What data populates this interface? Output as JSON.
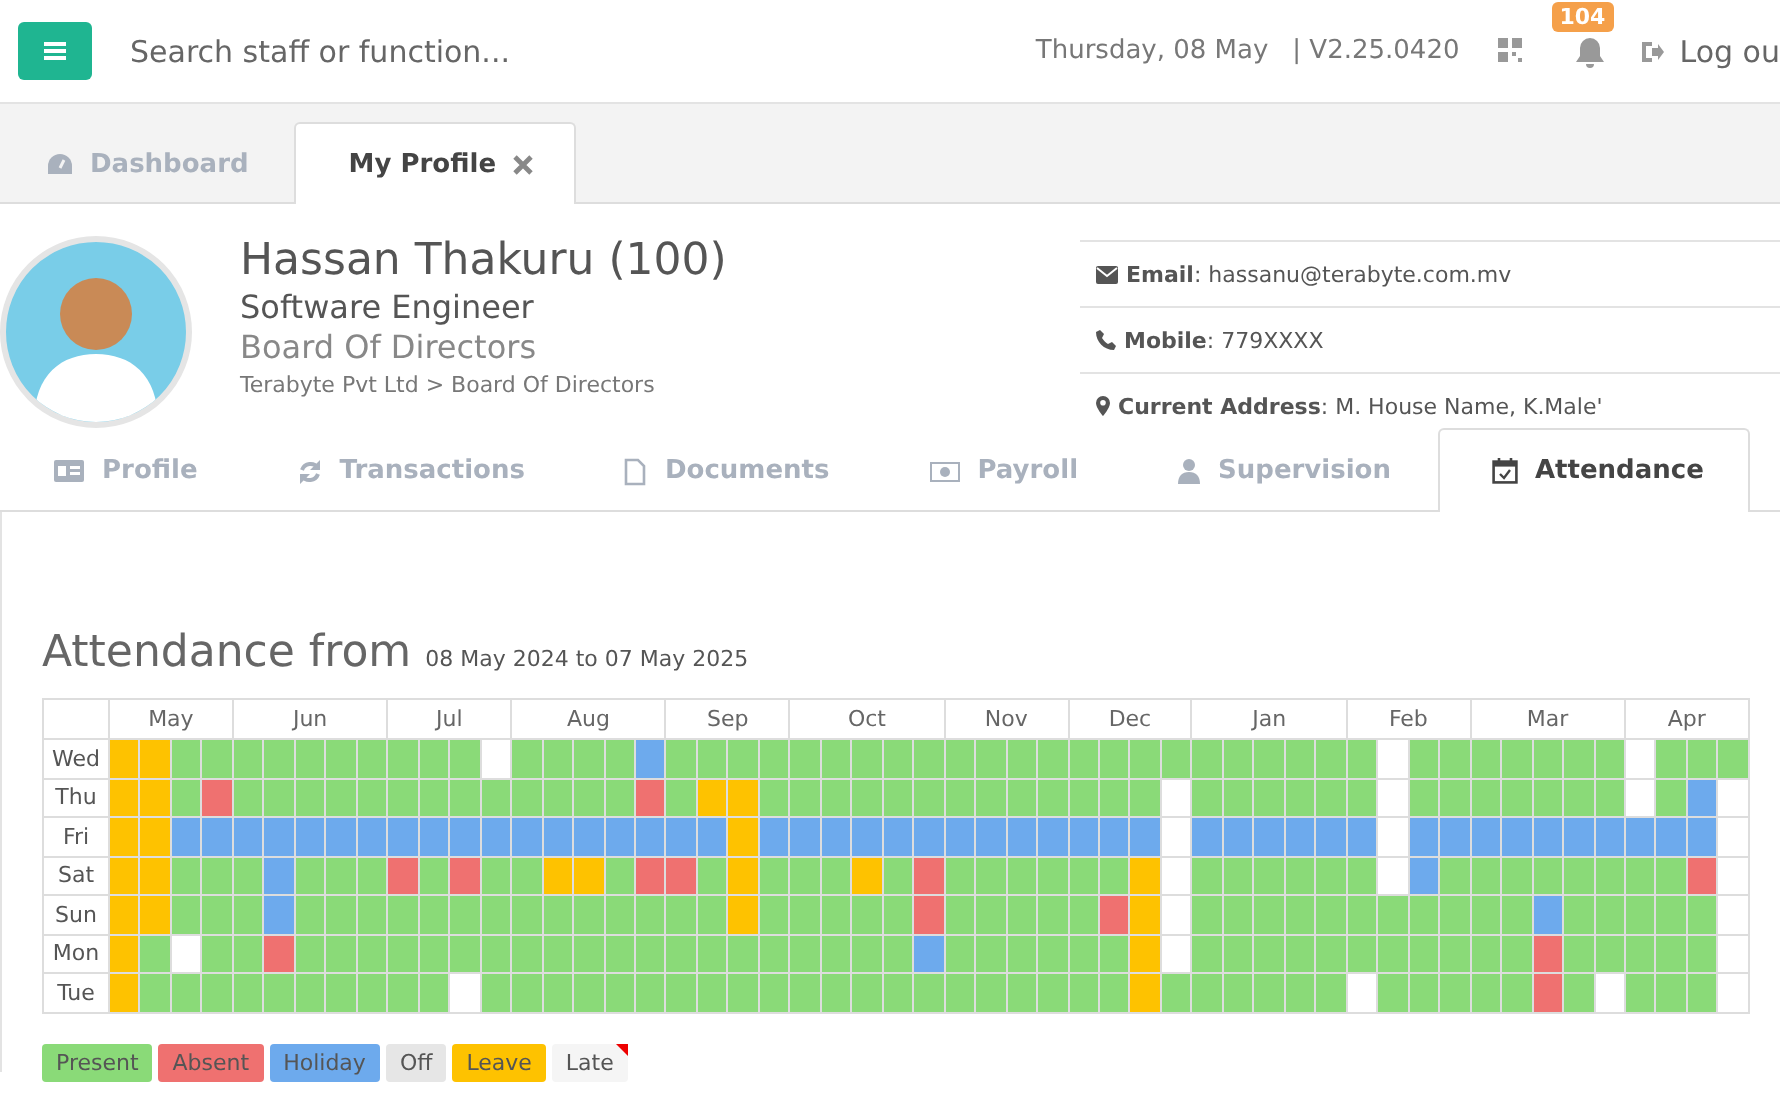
{
  "top_bar": {
    "search": {
      "placeholder": "Search staff or function..."
    },
    "date": "Thursday, 08 May",
    "version": "| V2.25.0420",
    "notifications": "104",
    "logout": "Log ou"
  },
  "page_tabs": [
    {
      "label": "Dashboard",
      "selected": false,
      "closable": false
    },
    {
      "label": "My Profile",
      "selected": true,
      "closable": true
    }
  ],
  "profile": {
    "name": "Hassan Thakuru (100)",
    "position": "Software Engineer",
    "department": "Board Of Directors",
    "breadcrumb": "Terabyte Pvt Ltd > Board Of Directors",
    "contacts": [
      {
        "kind": "email",
        "text": "**Email**: hassanu@terabyte.com.mv"
      },
      {
        "kind": "phone",
        "text": "**Mobile**: 779XXXX"
      },
      {
        "kind": "address",
        "text": "**Current Address**: M. House Name, K.Male'"
      }
    ]
  },
  "section_tabs": [
    {
      "kind": "profile",
      "label": "Profile",
      "selected": false
    },
    {
      "kind": "transactions",
      "label": "Transactions",
      "selected": false
    },
    {
      "kind": "documents",
      "label": "Documents",
      "selected": false
    },
    {
      "kind": "payroll",
      "label": "Payroll",
      "selected": false
    },
    {
      "kind": "supervision",
      "label": "Supervision",
      "selected": false
    },
    {
      "kind": "attendance",
      "label": "Attendance",
      "selected": true
    }
  ],
  "attendance": {
    "title": "Attendance from",
    "range": "08 May 2024 to 07 May 2025",
    "months": [
      "May",
      "Jun",
      "Jul",
      "Aug",
      "Sep",
      "Oct",
      "Nov",
      "Dec",
      "Jan",
      "Feb",
      "Mar",
      "Apr"
    ],
    "rows": [
      {
        "day": "Wed",
        "cells": [
          {
            "kind": "leave"
          },
          {
            "kind": "leave"
          },
          {
            "kind": "present"
          },
          {
            "kind": "present"
          },
          {
            "kind": "present"
          },
          {
            "kind": "present"
          },
          {
            "kind": "present"
          },
          {
            "kind": "present"
          },
          {
            "kind": "present"
          },
          {
            "kind": "present"
          },
          {
            "kind": "present"
          },
          {
            "kind": "present"
          },
          {
            "kind": "none"
          },
          {
            "kind": "present"
          },
          {
            "kind": "present"
          },
          {
            "kind": "present"
          },
          {
            "kind": "present"
          },
          {
            "kind": "holiday"
          },
          {
            "kind": "present"
          },
          {
            "kind": "present"
          },
          {
            "kind": "present"
          },
          {
            "kind": "present"
          },
          {
            "kind": "present"
          },
          {
            "kind": "present"
          },
          {
            "kind": "present"
          },
          {
            "kind": "present"
          },
          {
            "kind": "present"
          },
          {
            "kind": "present"
          },
          {
            "kind": "present"
          },
          {
            "kind": "present"
          },
          {
            "kind": "present"
          },
          {
            "kind": "present"
          },
          {
            "kind": "present"
          },
          {
            "kind": "present"
          },
          {
            "kind": "present"
          },
          {
            "kind": "present"
          },
          {
            "kind": "present"
          },
          {
            "kind": "present"
          },
          {
            "kind": "present"
          },
          {
            "kind": "present"
          },
          {
            "kind": "present"
          },
          {
            "kind": "none"
          },
          {
            "kind": "present"
          },
          {
            "kind": "present"
          },
          {
            "kind": "present"
          },
          {
            "kind": "present"
          },
          {
            "kind": "present"
          },
          {
            "kind": "present"
          },
          {
            "kind": "present"
          },
          {
            "kind": "none"
          },
          {
            "kind": "present"
          },
          {
            "kind": "present"
          },
          {
            "kind": "present"
          }
        ]
      },
      {
        "day": "Thu",
        "cells": [
          {
            "kind": "leave"
          },
          {
            "kind": "leave"
          },
          {
            "kind": "present"
          },
          {
            "kind": "absent"
          },
          {
            "kind": "present"
          },
          {
            "kind": "present"
          },
          {
            "kind": "present"
          },
          {
            "kind": "present"
          },
          {
            "kind": "present"
          },
          {
            "kind": "present"
          },
          {
            "kind": "present"
          },
          {
            "kind": "present"
          },
          {
            "kind": "present"
          },
          {
            "kind": "present"
          },
          {
            "kind": "present"
          },
          {
            "kind": "present"
          },
          {
            "kind": "present"
          },
          {
            "kind": "absent"
          },
          {
            "kind": "present"
          },
          {
            "kind": "leave"
          },
          {
            "kind": "leave"
          },
          {
            "kind": "present"
          },
          {
            "kind": "present"
          },
          {
            "kind": "present"
          },
          {
            "kind": "present"
          },
          {
            "kind": "present"
          },
          {
            "kind": "present"
          },
          {
            "kind": "present"
          },
          {
            "kind": "present"
          },
          {
            "kind": "present"
          },
          {
            "kind": "present"
          },
          {
            "kind": "present"
          },
          {
            "kind": "present"
          },
          {
            "kind": "present"
          },
          {
            "kind": "none"
          },
          {
            "kind": "present"
          },
          {
            "kind": "present"
          },
          {
            "kind": "present"
          },
          {
            "kind": "present"
          },
          {
            "kind": "present"
          },
          {
            "kind": "present"
          },
          {
            "kind": "none"
          },
          {
            "kind": "present"
          },
          {
            "kind": "present"
          },
          {
            "kind": "present"
          },
          {
            "kind": "present"
          },
          {
            "kind": "present"
          },
          {
            "kind": "present"
          },
          {
            "kind": "present"
          },
          {
            "kind": "none"
          },
          {
            "kind": "present"
          },
          {
            "kind": "holiday"
          },
          {
            "kind": "none"
          }
        ]
      },
      {
        "day": "Fri",
        "cells": [
          {
            "kind": "leave"
          },
          {
            "kind": "leave"
          },
          {
            "kind": "holiday"
          },
          {
            "kind": "holiday"
          },
          {
            "kind": "holiday"
          },
          {
            "kind": "holiday"
          },
          {
            "kind": "holiday"
          },
          {
            "kind": "holiday"
          },
          {
            "kind": "holiday"
          },
          {
            "kind": "holiday"
          },
          {
            "kind": "holiday"
          },
          {
            "kind": "holiday"
          },
          {
            "kind": "holiday"
          },
          {
            "kind": "holiday"
          },
          {
            "kind": "holiday"
          },
          {
            "kind": "holiday"
          },
          {
            "kind": "holiday"
          },
          {
            "kind": "holiday"
          },
          {
            "kind": "holiday"
          },
          {
            "kind": "holiday"
          },
          {
            "kind": "leave"
          },
          {
            "kind": "holiday"
          },
          {
            "kind": "holiday"
          },
          {
            "kind": "holiday"
          },
          {
            "kind": "holiday"
          },
          {
            "kind": "holiday"
          },
          {
            "kind": "holiday"
          },
          {
            "kind": "holiday"
          },
          {
            "kind": "holiday"
          },
          {
            "kind": "holiday"
          },
          {
            "kind": "holiday"
          },
          {
            "kind": "holiday"
          },
          {
            "kind": "holiday"
          },
          {
            "kind": "holiday"
          },
          {
            "kind": "none"
          },
          {
            "kind": "holiday"
          },
          {
            "kind": "holiday"
          },
          {
            "kind": "holiday"
          },
          {
            "kind": "holiday"
          },
          {
            "kind": "holiday"
          },
          {
            "kind": "holiday"
          },
          {
            "kind": "none"
          },
          {
            "kind": "holiday"
          },
          {
            "kind": "holiday"
          },
          {
            "kind": "holiday"
          },
          {
            "kind": "holiday"
          },
          {
            "kind": "holiday"
          },
          {
            "kind": "holiday"
          },
          {
            "kind": "holiday"
          },
          {
            "kind": "holiday"
          },
          {
            "kind": "holiday"
          },
          {
            "kind": "holiday"
          },
          {
            "kind": "none"
          }
        ]
      },
      {
        "day": "Sat",
        "cells": [
          {
            "kind": "leave"
          },
          {
            "kind": "leave"
          },
          {
            "kind": "present"
          },
          {
            "kind": "present"
          },
          {
            "kind": "present"
          },
          {
            "kind": "holiday"
          },
          {
            "kind": "present"
          },
          {
            "kind": "present"
          },
          {
            "kind": "present"
          },
          {
            "kind": "absent"
          },
          {
            "kind": "present"
          },
          {
            "kind": "absent"
          },
          {
            "kind": "present"
          },
          {
            "kind": "present"
          },
          {
            "kind": "leave"
          },
          {
            "kind": "leave"
          },
          {
            "kind": "present"
          },
          {
            "kind": "absent"
          },
          {
            "kind": "absent"
          },
          {
            "kind": "present"
          },
          {
            "kind": "leave"
          },
          {
            "kind": "present"
          },
          {
            "kind": "present"
          },
          {
            "kind": "present"
          },
          {
            "kind": "leave"
          },
          {
            "kind": "present"
          },
          {
            "kind": "absent"
          },
          {
            "kind": "present"
          },
          {
            "kind": "present"
          },
          {
            "kind": "present"
          },
          {
            "kind": "present"
          },
          {
            "kind": "present"
          },
          {
            "kind": "present"
          },
          {
            "kind": "leave"
          },
          {
            "kind": "none"
          },
          {
            "kind": "present"
          },
          {
            "kind": "present"
          },
          {
            "kind": "present"
          },
          {
            "kind": "present"
          },
          {
            "kind": "present"
          },
          {
            "kind": "present"
          },
          {
            "kind": "none"
          },
          {
            "kind": "holiday"
          },
          {
            "kind": "present"
          },
          {
            "kind": "present"
          },
          {
            "kind": "present"
          },
          {
            "kind": "present"
          },
          {
            "kind": "present"
          },
          {
            "kind": "present"
          },
          {
            "kind": "present"
          },
          {
            "kind": "present"
          },
          {
            "kind": "absent"
          },
          {
            "kind": "none"
          }
        ]
      },
      {
        "day": "Sun",
        "cells": [
          {
            "kind": "leave"
          },
          {
            "kind": "leave"
          },
          {
            "kind": "present"
          },
          {
            "kind": "present"
          },
          {
            "kind": "present"
          },
          {
            "kind": "holiday"
          },
          {
            "kind": "present"
          },
          {
            "kind": "present"
          },
          {
            "kind": "present"
          },
          {
            "kind": "present"
          },
          {
            "kind": "present"
          },
          {
            "kind": "present"
          },
          {
            "kind": "present"
          },
          {
            "kind": "present"
          },
          {
            "kind": "present"
          },
          {
            "kind": "present"
          },
          {
            "kind": "present"
          },
          {
            "kind": "present"
          },
          {
            "kind": "present"
          },
          {
            "kind": "present"
          },
          {
            "kind": "leave"
          },
          {
            "kind": "present"
          },
          {
            "kind": "present"
          },
          {
            "kind": "present"
          },
          {
            "kind": "present"
          },
          {
            "kind": "present"
          },
          {
            "kind": "absent"
          },
          {
            "kind": "present"
          },
          {
            "kind": "present"
          },
          {
            "kind": "present"
          },
          {
            "kind": "present"
          },
          {
            "kind": "present"
          },
          {
            "kind": "absent"
          },
          {
            "kind": "leave"
          },
          {
            "kind": "none"
          },
          {
            "kind": "present"
          },
          {
            "kind": "present"
          },
          {
            "kind": "present"
          },
          {
            "kind": "present"
          },
          {
            "kind": "present"
          },
          {
            "kind": "present"
          },
          {
            "kind": "present"
          },
          {
            "kind": "present"
          },
          {
            "kind": "present"
          },
          {
            "kind": "present"
          },
          {
            "kind": "present"
          },
          {
            "kind": "holiday"
          },
          {
            "kind": "present"
          },
          {
            "kind": "present"
          },
          {
            "kind": "present"
          },
          {
            "kind": "present"
          },
          {
            "kind": "present"
          },
          {
            "kind": "none"
          }
        ]
      },
      {
        "day": "Mon",
        "cells": [
          {
            "kind": "leave"
          },
          {
            "kind": "present"
          },
          {
            "kind": "none"
          },
          {
            "kind": "present"
          },
          {
            "kind": "present"
          },
          {
            "kind": "absent"
          },
          {
            "kind": "present"
          },
          {
            "kind": "present"
          },
          {
            "kind": "present"
          },
          {
            "kind": "present"
          },
          {
            "kind": "present"
          },
          {
            "kind": "present"
          },
          {
            "kind": "present"
          },
          {
            "kind": "present"
          },
          {
            "kind": "present"
          },
          {
            "kind": "present"
          },
          {
            "kind": "present"
          },
          {
            "kind": "present"
          },
          {
            "kind": "present"
          },
          {
            "kind": "present"
          },
          {
            "kind": "present"
          },
          {
            "kind": "present"
          },
          {
            "kind": "present"
          },
          {
            "kind": "present"
          },
          {
            "kind": "present"
          },
          {
            "kind": "present"
          },
          {
            "kind": "holiday"
          },
          {
            "kind": "present"
          },
          {
            "kind": "present"
          },
          {
            "kind": "present"
          },
          {
            "kind": "present"
          },
          {
            "kind": "present"
          },
          {
            "kind": "present"
          },
          {
            "kind": "leave"
          },
          {
            "kind": "none"
          },
          {
            "kind": "present"
          },
          {
            "kind": "present"
          },
          {
            "kind": "present"
          },
          {
            "kind": "present"
          },
          {
            "kind": "present"
          },
          {
            "kind": "present"
          },
          {
            "kind": "present"
          },
          {
            "kind": "present"
          },
          {
            "kind": "present"
          },
          {
            "kind": "present"
          },
          {
            "kind": "present"
          },
          {
            "kind": "absent"
          },
          {
            "kind": "present"
          },
          {
            "kind": "present"
          },
          {
            "kind": "present"
          },
          {
            "kind": "present"
          },
          {
            "kind": "present"
          },
          {
            "kind": "none"
          }
        ]
      },
      {
        "day": "Tue",
        "cells": [
          {
            "kind": "leave"
          },
          {
            "kind": "present"
          },
          {
            "kind": "present"
          },
          {
            "kind": "present"
          },
          {
            "kind": "present"
          },
          {
            "kind": "present"
          },
          {
            "kind": "present"
          },
          {
            "kind": "present"
          },
          {
            "kind": "present"
          },
          {
            "kind": "present"
          },
          {
            "kind": "present"
          },
          {
            "kind": "none"
          },
          {
            "kind": "present"
          },
          {
            "kind": "present"
          },
          {
            "kind": "present"
          },
          {
            "kind": "present"
          },
          {
            "kind": "present"
          },
          {
            "kind": "present"
          },
          {
            "kind": "present"
          },
          {
            "kind": "present"
          },
          {
            "kind": "present"
          },
          {
            "kind": "present"
          },
          {
            "kind": "present"
          },
          {
            "kind": "present"
          },
          {
            "kind": "present"
          },
          {
            "kind": "present"
          },
          {
            "kind": "present"
          },
          {
            "kind": "present"
          },
          {
            "kind": "present"
          },
          {
            "kind": "present"
          },
          {
            "kind": "present"
          },
          {
            "kind": "present"
          },
          {
            "kind": "present"
          },
          {
            "kind": "leave"
          },
          {
            "kind": "present"
          },
          {
            "kind": "present"
          },
          {
            "kind": "present"
          },
          {
            "kind": "present"
          },
          {
            "kind": "present"
          },
          {
            "kind": "present"
          },
          {
            "kind": "none"
          },
          {
            "kind": "present"
          },
          {
            "kind": "present"
          },
          {
            "kind": "present"
          },
          {
            "kind": "present"
          },
          {
            "kind": "present"
          },
          {
            "kind": "absent"
          },
          {
            "kind": "present"
          },
          {
            "kind": "none"
          },
          {
            "kind": "present"
          },
          {
            "kind": "present"
          },
          {
            "kind": "present"
          },
          {
            "kind": "none"
          }
        ]
      }
    ],
    "legend": [
      {
        "kind": "present",
        "label": "Present",
        "color": "#8ada78"
      },
      {
        "kind": "absent",
        "label": "Absent",
        "color": "#ef7170"
      },
      {
        "kind": "holiday",
        "label": "Holiday",
        "color": "#6daaed"
      },
      {
        "kind": "off",
        "label": "Off",
        "color": "#e6e6e6"
      },
      {
        "kind": "leave",
        "label": "Leave",
        "color": "#fec200"
      },
      {
        "kind": "late",
        "label": "Late",
        "color": "#f5f5f5"
      }
    ]
  }
}
